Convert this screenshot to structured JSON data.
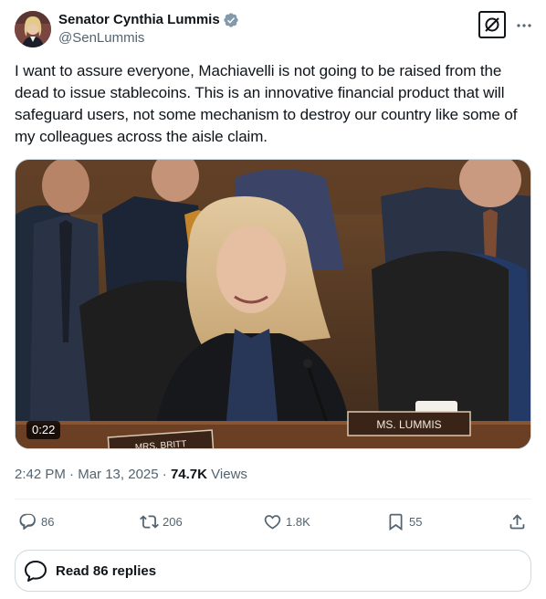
{
  "author": {
    "display_name": "Senator Cynthia Lummis",
    "handle": "@SenLummis"
  },
  "tweet": {
    "text": "I want to assure everyone, Machiavelli is not going to be raised from the dead to issue stablecoins. This is an innovative financial product that will safeguard users, not some mechanism to destroy our country like some of my colleagues across the aisle claim."
  },
  "media": {
    "duration": "0:22",
    "nameplate_main": "MS. LUMMIS",
    "nameplate_side": "MRS. BRITT"
  },
  "meta": {
    "time": "2:42 PM",
    "separator": "·",
    "date": "Mar 13, 2025",
    "views_count": "74.7K",
    "views_label": "Views"
  },
  "actions": {
    "replies": "86",
    "reposts": "206",
    "likes": "1.8K",
    "bookmarks": "55"
  },
  "read_replies_label": "Read 86 replies",
  "colors": {
    "text_primary": "#0f1419",
    "text_secondary": "#536471",
    "verified": "#829aab",
    "border": "#cfd9de"
  }
}
